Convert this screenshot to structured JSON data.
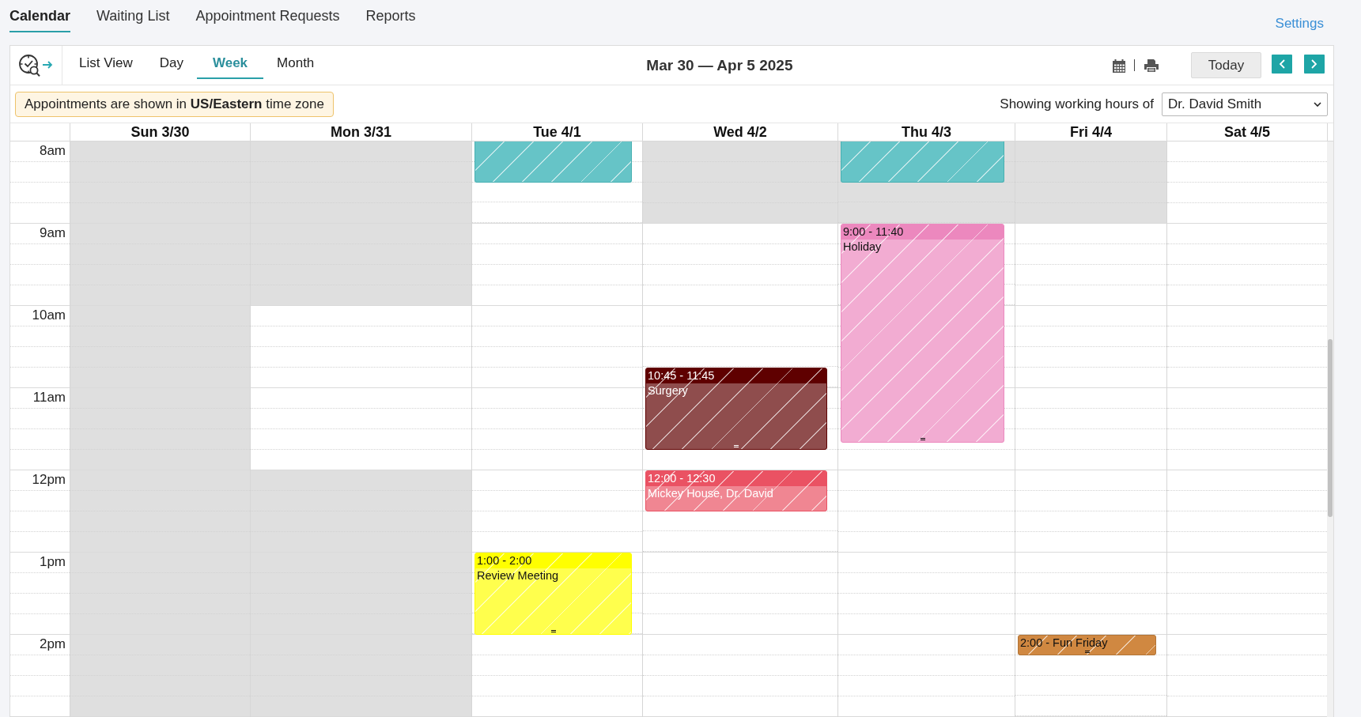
{
  "tabs": [
    {
      "label": "Calendar",
      "selected": true
    },
    {
      "label": "Waiting List",
      "selected": false
    },
    {
      "label": "Appointment Requests",
      "selected": false
    },
    {
      "label": "Reports",
      "selected": false
    }
  ],
  "settings_link": "Settings",
  "toolbar": {
    "views": [
      {
        "label": "List View",
        "selected": false
      },
      {
        "label": "Day",
        "selected": false
      },
      {
        "label": "Week",
        "selected": true
      },
      {
        "label": "Month",
        "selected": false
      }
    ],
    "title": "Mar 30 — Apr 5 2025",
    "today_button": "Today"
  },
  "notice": "Appointments are shown in **US/Eastern** time zone",
  "working_hours": {
    "label": "Showing working hours of",
    "provider": "Dr. David Smith"
  },
  "calendar": {
    "time_labels": [
      "8am",
      "9am",
      "10am",
      "11am",
      "12pm",
      "1pm",
      "2pm"
    ],
    "days": [
      {
        "label": "Sun 3/30",
        "hours": [
          {
            "available": false
          },
          {
            "available": false
          },
          {
            "available": false
          },
          {
            "available": false
          },
          {
            "available": false
          },
          {
            "available": false
          },
          {
            "available": false
          }
        ]
      },
      {
        "label": "Mon 3/31",
        "hours": [
          {
            "available": false
          },
          {
            "available": false
          },
          {
            "available": true
          },
          {
            "available": true
          },
          {
            "available": false
          },
          {
            "available": false
          },
          {
            "available": false
          }
        ]
      },
      {
        "label": "Tue 4/1",
        "hours": [
          {
            "available": true,
            "events": [
              {
                "kind": "block",
                "color": "#66c4c7",
                "resizable": false
              }
            ]
          },
          {
            "available": true
          },
          {
            "available": true
          },
          {
            "available": true
          },
          {
            "available": true
          },
          {
            "available": true,
            "events": [
              {
                "kind": "detailed",
                "time": "1:00 - 2:00",
                "title": "Review Meeting",
                "color": "#ffff00",
                "resizable": true
              }
            ]
          },
          {
            "available": true
          }
        ]
      },
      {
        "label": "Wed 4/2",
        "hours": [
          {
            "available": false
          },
          {
            "available": true
          },
          {
            "available": true,
            "events": [
              {
                "kind": "detailed",
                "time": "10:45 - 11:45",
                "title": "Surgery",
                "color": "#5f0000",
                "resizable": true
              }
            ]
          },
          {
            "available": true
          },
          {
            "available": true,
            "events": [
              {
                "kind": "detailed",
                "time": "12:00 - 12:30",
                "title": "Mickey House, Dr. David",
                "color": "#ea5263",
                "resizable": false
              }
            ]
          },
          {
            "available": true
          },
          {
            "available": true
          }
        ]
      },
      {
        "label": "Thu 4/3",
        "hours": [
          {
            "available": false,
            "events": [
              {
                "kind": "block",
                "color": "#66c4c7",
                "resizable": false
              }
            ]
          },
          {
            "available": true,
            "events": [
              {
                "kind": "detailed",
                "time": "9:00 - 11:40",
                "title": "Holiday",
                "color": "#ec88be",
                "resizable": true
              }
            ]
          },
          {
            "available": true
          },
          {
            "available": true
          },
          {
            "available": true
          },
          {
            "available": true
          },
          {
            "available": true
          }
        ]
      },
      {
        "label": "Fri 4/4",
        "hours": [
          {
            "available": false
          },
          {
            "available": true
          },
          {
            "available": true
          },
          {
            "available": true
          },
          {
            "available": true
          },
          {
            "available": true
          },
          {
            "available": true,
            "events": [
              {
                "kind": "compact",
                "text": "2:00 - Fun Friday",
                "color": "#d08841",
                "resizable": true
              }
            ]
          }
        ]
      },
      {
        "label": "Sat 4/5",
        "hours": [
          {
            "available": true
          },
          {
            "available": true
          },
          {
            "available": true
          },
          {
            "available": true
          },
          {
            "available": true
          },
          {
            "available": true
          },
          {
            "available": true
          }
        ]
      }
    ]
  }
}
